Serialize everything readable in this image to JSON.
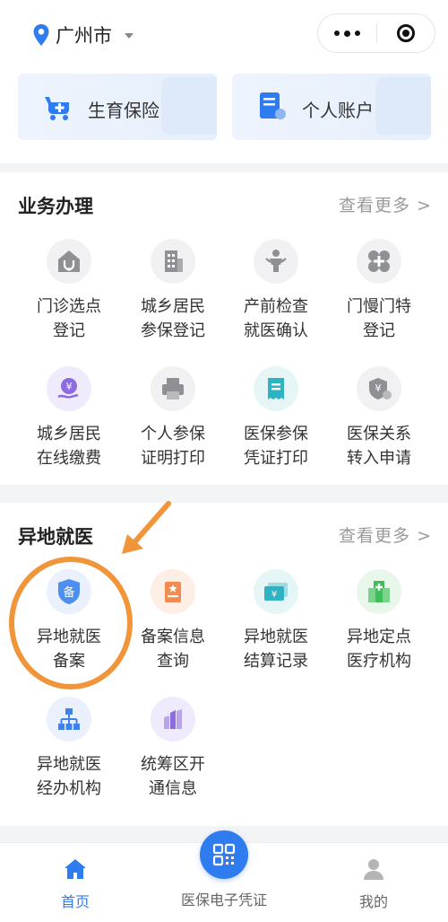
{
  "location": {
    "city": "广州市"
  },
  "quick_cards": [
    {
      "label": "生育保险",
      "icon": "baby-stroller-plus-icon"
    },
    {
      "label": "个人账户",
      "icon": "account-document-icon"
    }
  ],
  "business": {
    "title": "业务办理",
    "more": "查看更多 >",
    "items": [
      {
        "line1": "门诊选点",
        "line2": "登记",
        "icon": "clinic-house-icon"
      },
      {
        "line1": "城乡居民",
        "line2": "参保登记",
        "icon": "building-icon"
      },
      {
        "line1": "产前检查",
        "line2": "就医确认",
        "icon": "pregnant-person-icon"
      },
      {
        "line1": "门慢门特",
        "line2": "登记",
        "icon": "medical-cross-icon"
      },
      {
        "line1": "城乡居民",
        "line2": "在线缴费",
        "icon": "yuan-hand-icon"
      },
      {
        "line1": "个人参保",
        "line2": "证明打印",
        "icon": "printer-icon"
      },
      {
        "line1": "医保参保",
        "line2": "凭证打印",
        "icon": "receipt-icon"
      },
      {
        "line1": "医保关系",
        "line2": "转入申请",
        "icon": "yuan-shield-transfer-icon"
      }
    ]
  },
  "remote": {
    "title": "异地就医",
    "more": "查看更多 >",
    "items": [
      {
        "line1": "异地就医",
        "line2": "备案",
        "icon": "shield-bei-icon",
        "badge": "备"
      },
      {
        "line1": "备案信息",
        "line2": "查询",
        "icon": "info-card-icon"
      },
      {
        "line1": "异地就医",
        "line2": "结算记录",
        "icon": "payment-card-icon"
      },
      {
        "line1": "异地定点",
        "line2": "医疗机构",
        "icon": "hospital-icon"
      },
      {
        "line1": "异地就医",
        "line2": "经办机构",
        "icon": "org-chart-icon"
      },
      {
        "line1": "统筹区开",
        "line2": "通信息",
        "icon": "bar-chart-icon"
      }
    ]
  },
  "tabbar": {
    "home": "首页",
    "voucher": "医保电子凭证",
    "mine": "我的"
  },
  "colors": {
    "accent": "#2f7cf0",
    "annotation": "#f0953a",
    "muted": "#9a9a9a"
  }
}
